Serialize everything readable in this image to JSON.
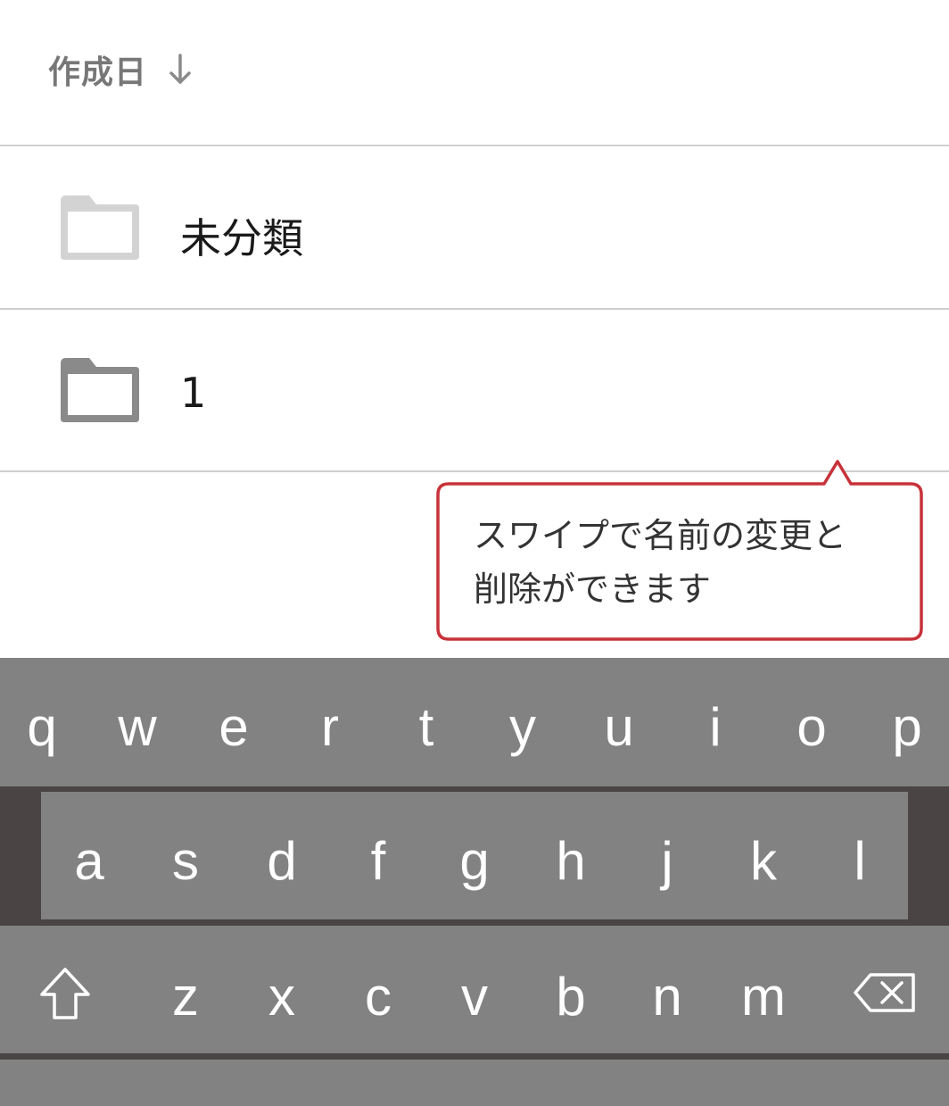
{
  "sort": {
    "label": "作成日",
    "direction_icon": "arrow-down-icon"
  },
  "folders": [
    {
      "name": "未分類",
      "icon": "folder-icon",
      "icon_color": "#d3d3d3"
    },
    {
      "name": "1",
      "icon": "folder-icon",
      "icon_color": "#8a8a8a"
    }
  ],
  "tooltip": {
    "line1": "スワイプで名前の変更と",
    "line2": "削除ができます",
    "border_color": "#c8323a"
  },
  "keyboard": {
    "row1": [
      "q",
      "w",
      "e",
      "r",
      "t",
      "y",
      "u",
      "i",
      "o",
      "p"
    ],
    "row2": [
      "a",
      "s",
      "d",
      "f",
      "g",
      "h",
      "j",
      "k",
      "l"
    ],
    "row3": [
      "z",
      "x",
      "c",
      "v",
      "b",
      "n",
      "m"
    ],
    "shift_icon": "shift-icon",
    "backspace_icon": "backspace-icon"
  }
}
